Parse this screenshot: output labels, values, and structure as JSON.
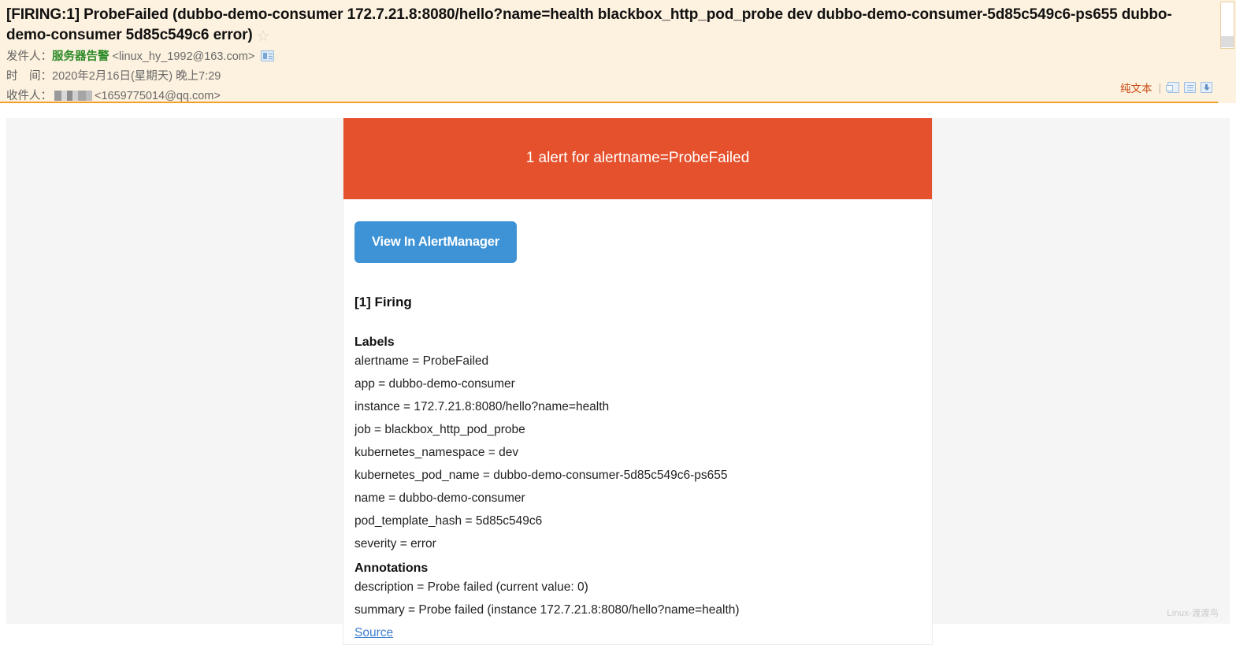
{
  "mail": {
    "subject": "[FIRING:1] ProbeFailed (dubbo-demo-consumer 172.7.21.8:8080/hello?name=health blackbox_http_pod_probe dev dubbo-demo-consumer-5d85c549c6-ps655 dubbo-demo-consumer 5d85c549c6 error)",
    "star_icon": "star-outline-icon",
    "from_label": "发件人：",
    "from_name": "服务器告警",
    "from_address": "<linux_hy_1992@163.com>",
    "from_card_icon": "contact-card-icon",
    "date_label": "时　间：",
    "date_value": "2020年2月16日(星期天) 晚上7:29",
    "to_label": "收件人：",
    "to_name_redacted": "",
    "to_address": "<1659775014@qq.com>"
  },
  "header_tools": {
    "plain_text": "纯文本",
    "separator": "|",
    "icons": [
      {
        "name": "new-window-icon"
      },
      {
        "name": "document-icon"
      },
      {
        "name": "download-icon"
      }
    ]
  },
  "alert": {
    "banner_title": "1 alert for alertname=ProbeFailed",
    "view_button": "View In AlertManager",
    "firing_heading": "[1] Firing",
    "labels_heading": "Labels",
    "labels": [
      "alertname = ProbeFailed",
      "app = dubbo-demo-consumer",
      "instance = 172.7.21.8:8080/hello?name=health",
      "job = blackbox_http_pod_probe",
      "kubernetes_namespace = dev",
      "kubernetes_pod_name = dubbo-demo-consumer-5d85c549c6-ps655",
      "name = dubbo-demo-consumer",
      "pod_template_hash = 5d85c549c6",
      "severity = error"
    ],
    "annotations_heading": "Annotations",
    "annotations": [
      "description = Probe failed (current value: 0)",
      "summary = Probe failed (instance 172.7.21.8:8080/hello?name=health)"
    ],
    "source_link": "Source"
  },
  "watermark": "Linux-渡渡鸟",
  "colors": {
    "banner": "#e5512c",
    "button": "#3d93d6",
    "header_bg": "#fdf1df",
    "header_rule": "#f0a12a",
    "sender_name": "#2b8a27",
    "plain_text_link": "#c84a14",
    "source_link": "#3e7fd0",
    "content_bg": "#f5f5f5"
  }
}
